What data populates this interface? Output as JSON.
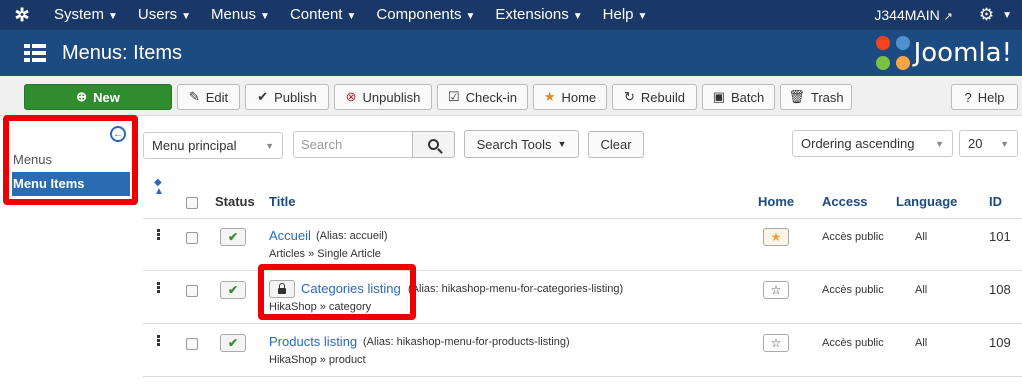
{
  "topnav": {
    "logo_icon": "joomla-icon",
    "items": [
      {
        "label": "System"
      },
      {
        "label": "Users"
      },
      {
        "label": "Menus"
      },
      {
        "label": "Content"
      },
      {
        "label": "Components"
      },
      {
        "label": "Extensions"
      },
      {
        "label": "Help"
      }
    ],
    "site_name": "J344MAIN",
    "site_icon": "external-link-icon",
    "settings_icon": "gear-icon"
  },
  "header": {
    "title": "Menus: Items",
    "brand": "Joomla!"
  },
  "toolbar": {
    "new": "New",
    "edit": "Edit",
    "publish": "Publish",
    "unpublish": "Unpublish",
    "checkin": "Check-in",
    "home": "Home",
    "rebuild": "Rebuild",
    "batch": "Batch",
    "trash": "Trash",
    "help": "Help"
  },
  "sidebar": {
    "items": [
      {
        "label": "Menus",
        "active": false
      },
      {
        "label": "Menu Items",
        "active": true
      }
    ]
  },
  "filters": {
    "menu_select": "Menu principal",
    "search_placeholder": "Search",
    "search_tools": "Search Tools",
    "clear": "Clear",
    "ordering": "Ordering ascending",
    "limit": "20"
  },
  "table": {
    "columns": {
      "status": "Status",
      "title": "Title",
      "home": "Home",
      "access": "Access",
      "language": "Language",
      "id": "ID"
    },
    "rows": [
      {
        "title": "Accueil",
        "alias": "(Alias: accueil)",
        "type": "Articles » Single Article",
        "home": true,
        "access": "Accès public",
        "language": "All",
        "id": "101",
        "locked": false
      },
      {
        "title": "Categories listing",
        "alias": "(Alias: hikashop-menu-for-categories-listing)",
        "type": "HikaShop » category",
        "home": false,
        "access": "Accès public",
        "language": "All",
        "id": "108",
        "locked": true
      },
      {
        "title": "Products listing",
        "alias": "(Alias: hikashop-menu-for-products-listing)",
        "type": "HikaShop » product",
        "home": false,
        "access": "Accès public",
        "language": "All",
        "id": "109",
        "locked": false
      }
    ]
  },
  "colors": {
    "nav": "#1a3867",
    "header": "#1c4b81",
    "new_button": "#2f8c2f",
    "highlight": "#e00000"
  }
}
